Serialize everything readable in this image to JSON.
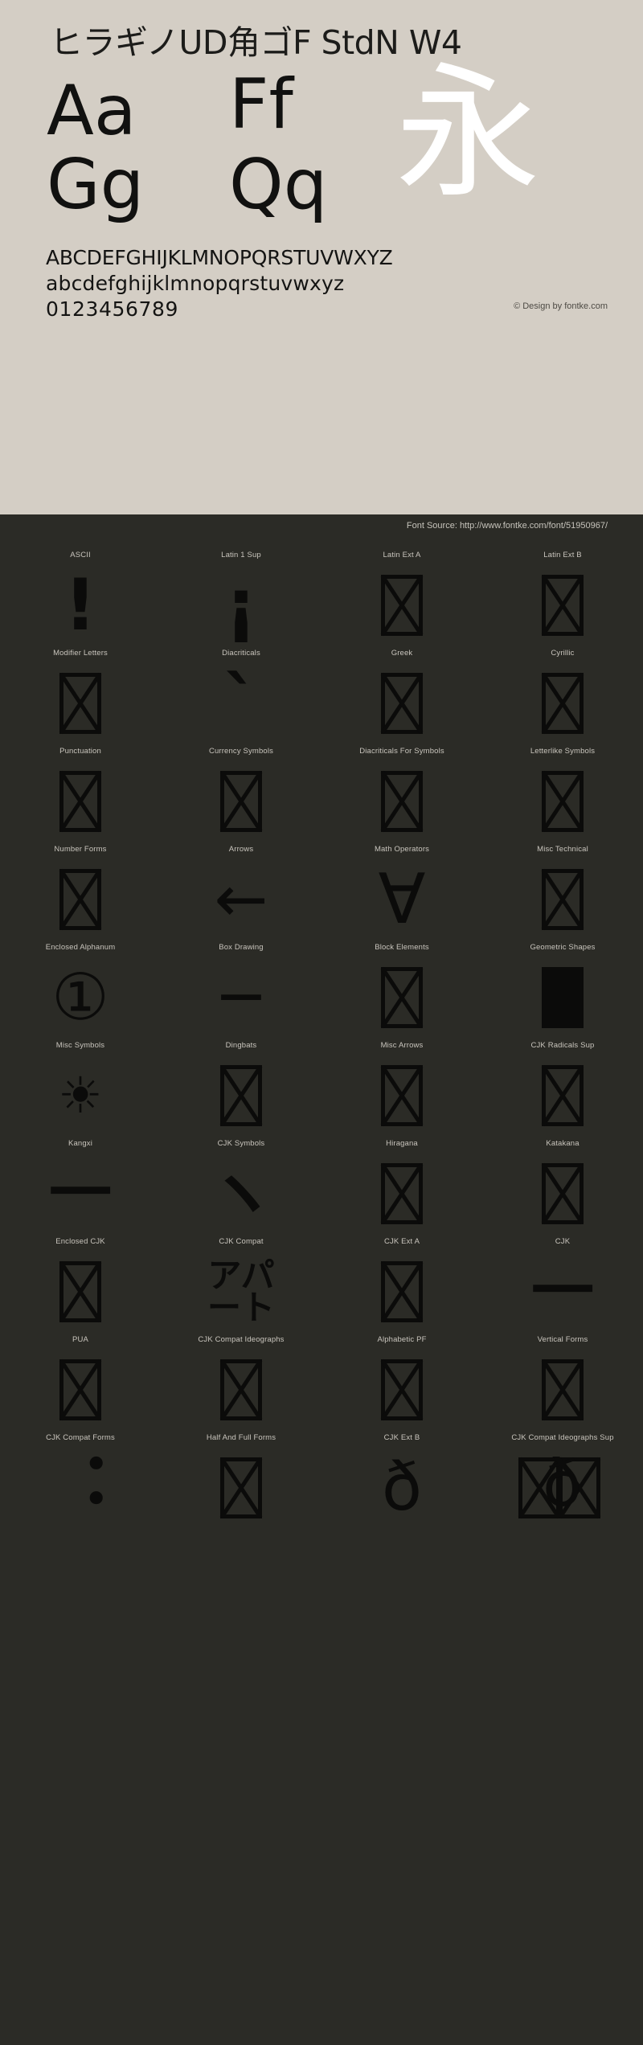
{
  "header": {
    "font_title": "ヒラギノUD角ゴF StdN W4",
    "samples": [
      {
        "name": "sample-aa",
        "text": "Aa"
      },
      {
        "name": "sample-ff",
        "text": "Ff"
      },
      {
        "name": "sample-gg",
        "text": "Gg"
      },
      {
        "name": "sample-qq",
        "text": "Qq"
      },
      {
        "name": "sample-kanji",
        "text": "永"
      }
    ],
    "alphabet_upper": "ABCDEFGHIJKLMNOPQRSTUVWXYZ",
    "alphabet_lower": "abcdefghijklmnopqrstuvwxyz",
    "digits": "0123456789",
    "design_credit": "© Design by fontke.com",
    "background_color": "#d4cec5",
    "text_color": "#141413",
    "kanji_color": "#ffffff"
  },
  "source_bar": {
    "text": "Font Source: http://www.fontke.com/font/51950967/",
    "background_color": "#2b2b26",
    "text_color": "#c6c3bb"
  },
  "block_grid": {
    "background_color": "#2b2b26",
    "label_color": "#c9c5bd",
    "glyph_color": "#0b0b0a",
    "columns": 4,
    "rows": [
      [
        {
          "label": "ASCII",
          "glyph": "!",
          "kind": "text",
          "cls": "g-excl"
        },
        {
          "label": "Latin 1 Sup",
          "glyph": "¡",
          "kind": "text",
          "cls": "g-iexcl"
        },
        {
          "label": "Latin Ext A",
          "glyph": "",
          "kind": "notdef",
          "cls": ""
        },
        {
          "label": "Latin Ext B",
          "glyph": "",
          "kind": "notdef",
          "cls": ""
        }
      ],
      [
        {
          "label": "Modifier Letters",
          "glyph": "",
          "kind": "notdef",
          "cls": ""
        },
        {
          "label": "Diacriticals",
          "glyph": "ˋ",
          "kind": "text",
          "cls": "g-grave"
        },
        {
          "label": "Greek",
          "glyph": "",
          "kind": "notdef",
          "cls": ""
        },
        {
          "label": "Cyrillic",
          "glyph": "",
          "kind": "notdef",
          "cls": ""
        }
      ],
      [
        {
          "label": "Punctuation",
          "glyph": "",
          "kind": "notdef",
          "cls": ""
        },
        {
          "label": "Currency Symbols",
          "glyph": "",
          "kind": "notdef",
          "cls": ""
        },
        {
          "label": "Diacriticals For Symbols",
          "glyph": "",
          "kind": "notdef",
          "cls": ""
        },
        {
          "label": "Letterlike Symbols",
          "glyph": "",
          "kind": "notdef",
          "cls": ""
        }
      ],
      [
        {
          "label": "Number Forms",
          "glyph": "",
          "kind": "notdef",
          "cls": ""
        },
        {
          "label": "Arrows",
          "glyph": "←",
          "kind": "text",
          "cls": "g-arrow"
        },
        {
          "label": "Math Operators",
          "glyph": "∀",
          "kind": "text",
          "cls": "g-forall"
        },
        {
          "label": "Misc Technical",
          "glyph": "",
          "kind": "notdef",
          "cls": ""
        }
      ],
      [
        {
          "label": "Enclosed Alphanum",
          "glyph": "①",
          "kind": "text",
          "cls": "g-circled"
        },
        {
          "label": "Box Drawing",
          "glyph": "─",
          "kind": "text",
          "cls": "g-boxdraw"
        },
        {
          "label": "Block Elements",
          "glyph": "",
          "kind": "notdef",
          "cls": ""
        },
        {
          "label": "Geometric Shapes",
          "glyph": "",
          "kind": "solid",
          "cls": ""
        }
      ],
      [
        {
          "label": "Misc Symbols",
          "glyph": "☀",
          "kind": "text",
          "cls": "g-sun"
        },
        {
          "label": "Dingbats",
          "glyph": "",
          "kind": "notdef",
          "cls": ""
        },
        {
          "label": "Misc Arrows",
          "glyph": "",
          "kind": "notdef",
          "cls": ""
        },
        {
          "label": "CJK Radicals Sup",
          "glyph": "",
          "kind": "notdef",
          "cls": ""
        }
      ],
      [
        {
          "label": "Kangxi",
          "glyph": "⼀",
          "kind": "text",
          "cls": "g-bar"
        },
        {
          "label": "CJK Symbols",
          "glyph": "ヽ",
          "kind": "text",
          "cls": "g-grave"
        },
        {
          "label": "Hiragana",
          "glyph": "",
          "kind": "notdef",
          "cls": ""
        },
        {
          "label": "Katakana",
          "glyph": "",
          "kind": "notdef",
          "cls": ""
        }
      ],
      [
        {
          "label": "Enclosed CJK",
          "glyph": "",
          "kind": "notdef",
          "cls": ""
        },
        {
          "label": "CJK Compat",
          "glyph": "アパ\nート",
          "kind": "text",
          "cls": "g-apart"
        },
        {
          "label": "CJK Ext A",
          "glyph": "",
          "kind": "notdef",
          "cls": ""
        },
        {
          "label": "CJK",
          "glyph": "一",
          "kind": "text",
          "cls": "g-ichi"
        }
      ],
      [
        {
          "label": "PUA",
          "glyph": "",
          "kind": "notdef",
          "cls": ""
        },
        {
          "label": "CJK Compat Ideographs",
          "glyph": "",
          "kind": "notdef",
          "cls": ""
        },
        {
          "label": "Alphabetic PF",
          "glyph": "",
          "kind": "notdef",
          "cls": ""
        },
        {
          "label": "Vertical Forms",
          "glyph": "",
          "kind": "notdef",
          "cls": ""
        }
      ],
      [
        {
          "label": "CJK Compat Forms",
          "glyph": "︓",
          "kind": "text",
          "cls": "g-colon"
        },
        {
          "label": "Half And Full Forms",
          "glyph": "",
          "kind": "notdef",
          "cls": ""
        },
        {
          "label": "CJK Ext B",
          "glyph": "ð",
          "kind": "text",
          "cls": "g-eth"
        },
        {
          "label": "CJK Compat Ideographs Sup",
          "glyph": "ð",
          "kind": "cluster",
          "cls": ""
        }
      ]
    ]
  }
}
